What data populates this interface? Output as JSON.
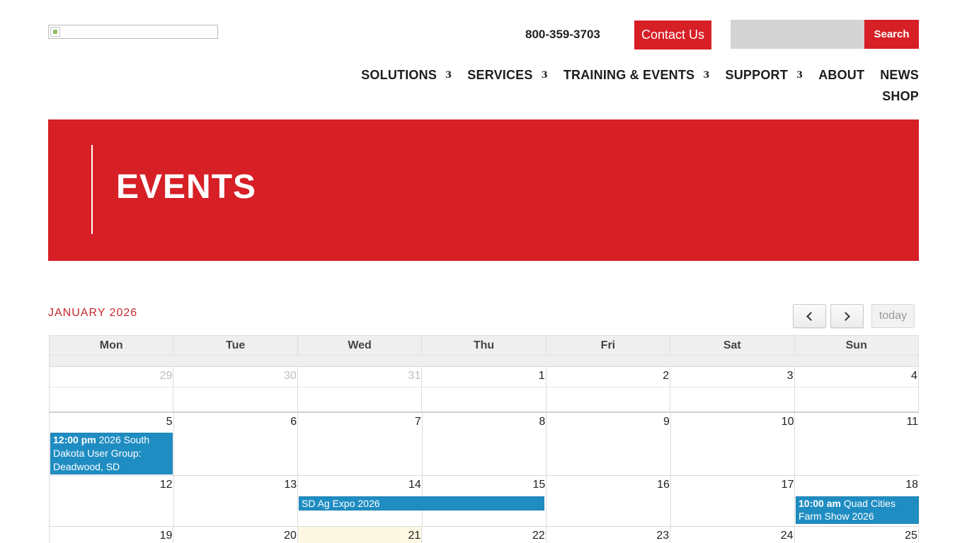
{
  "header": {
    "phone": "800-359-3703",
    "contact_label": "Contact Us",
    "search_placeholder": "",
    "search_label": "Search"
  },
  "nav": {
    "items": [
      {
        "label": "SOLUTIONS",
        "arrow": "3"
      },
      {
        "label": "SERVICES",
        "arrow": "3"
      },
      {
        "label": "TRAINING & EVENTS",
        "arrow": "3"
      },
      {
        "label": "SUPPORT",
        "arrow": "3"
      },
      {
        "label": "ABOUT"
      },
      {
        "label": "NEWS"
      },
      {
        "label": "SHOP"
      }
    ]
  },
  "hero": {
    "title": "EVENTS"
  },
  "calendar": {
    "month_title": "JANUARY 2026",
    "today_label": "today",
    "weekdays": [
      "Mon",
      "Tue",
      "Wed",
      "Thu",
      "Fri",
      "Sat",
      "Sun"
    ],
    "weeks": [
      [
        "29",
        "30",
        "31",
        "1",
        "2",
        "3",
        "4"
      ],
      [
        "5",
        "6",
        "7",
        "8",
        "9",
        "10",
        "11"
      ],
      [
        "12",
        "13",
        "14",
        "15",
        "16",
        "17",
        "18"
      ],
      [
        "19",
        "20",
        "21",
        "22",
        "23",
        "24",
        "25"
      ]
    ],
    "events": [
      {
        "time": "12:00 pm",
        "title": "2026 South Dakota User Group: Deadwood, SD"
      },
      {
        "time": "",
        "title": "SD Ag Expo 2026"
      },
      {
        "time": "10:00 am",
        "title": "Quad Cities Farm Show 2026"
      }
    ],
    "colors": {
      "event": "#1f8dc2",
      "today_bg": "#fcf8e3",
      "accent": "#d71f26"
    }
  }
}
